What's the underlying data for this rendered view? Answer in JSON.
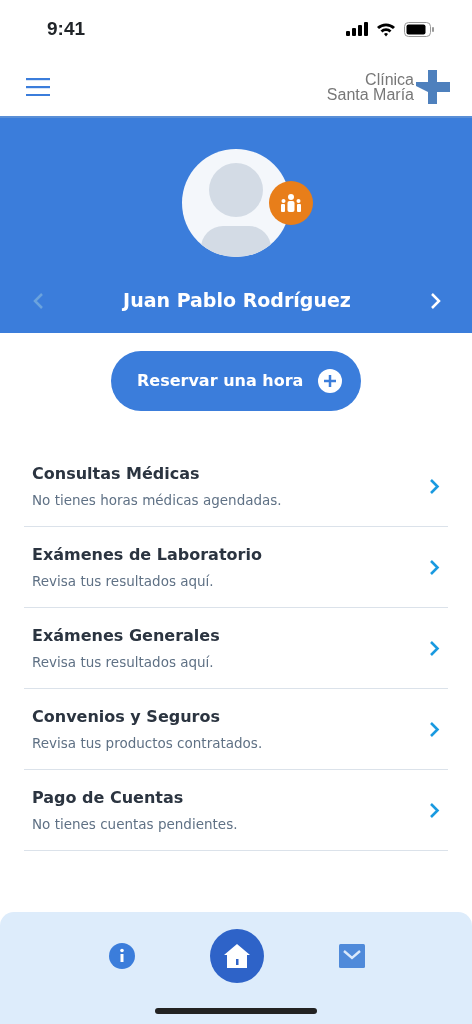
{
  "status_bar": {
    "time": "9:41"
  },
  "header": {
    "logo_line_1": "Clínica",
    "logo_line_2": "Santa María"
  },
  "profile": {
    "name": "Juan Pablo Rodríguez",
    "prev_disabled": true,
    "next_disabled": false
  },
  "book_button": {
    "label": "Reservar una hora"
  },
  "menu_items": [
    {
      "title": "Consultas Médicas",
      "subtitle": "No tienes horas médicas agendadas."
    },
    {
      "title": "Exámenes de Laboratorio",
      "subtitle": "Revisa tus resultados aquí."
    },
    {
      "title": "Exámenes Generales",
      "subtitle": "Revisa tus resultados aquí."
    },
    {
      "title": "Convenios y Seguros",
      "subtitle": "Revisa tus productos contratados."
    },
    {
      "title": "Pago de Cuentas",
      "subtitle": "No tienes cuentas pendientes."
    }
  ],
  "bottom_nav": [
    {
      "kind": "info",
      "selected": false
    },
    {
      "kind": "home",
      "selected": true
    },
    {
      "kind": "mail",
      "selected": false
    }
  ]
}
